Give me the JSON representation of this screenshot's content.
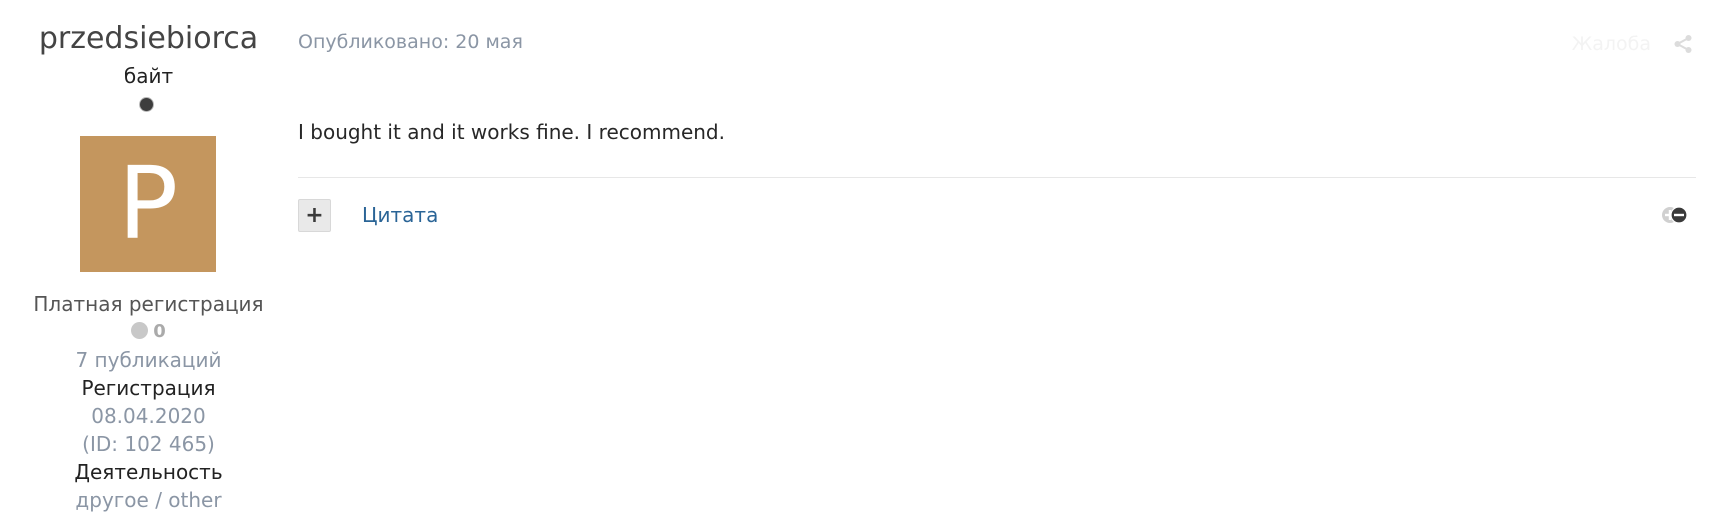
{
  "author": {
    "name": "przedsiebiorca",
    "rank": "байт",
    "avatar_letter": "P",
    "avatar_color": "#c4965e",
    "title": "Платная регистрация",
    "reputation": "0",
    "posts": "7 публикаций",
    "registration_label": "Регистрация",
    "registration_date": "08.04.2020",
    "id_text": "(ID: 102 465)",
    "activity_label": "Деятельность",
    "activity_value": "другое / other"
  },
  "post": {
    "meta": "Опубликовано: 20 мая",
    "content": "I bought it and it works fine. I recommend.",
    "report_label": "Жалоба",
    "quote_label": "Цитата",
    "multiquote_symbol": "+"
  },
  "icons": {
    "share": "share-icon",
    "hide_toggle": "ignore-toggle-icon",
    "online": "online-status-dot"
  },
  "colors": {
    "link": "#2a6496",
    "muted": "#8b96a5",
    "avatar": "#c4965e"
  }
}
